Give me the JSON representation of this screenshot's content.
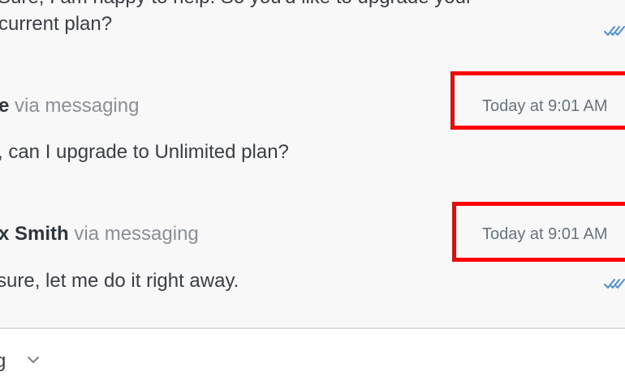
{
  "thread": {
    "messages": [
      {
        "partial_top_line": "Sure, I am happy to help. So you'd like to upgrade your",
        "continuation": "current plan?",
        "read_receipt_icon": "double-check-icon"
      },
      {
        "sender": "e",
        "channel": " via messaging",
        "timestamp": "Today at 9:01 AM",
        "body": ", can I upgrade to Unlimited plan?"
      },
      {
        "sender": "x Smith",
        "channel": " via messaging",
        "timestamp": "Today at 9:01 AM",
        "body": " sure, let me do it right away.",
        "read_receipt_icon": "double-check-icon"
      }
    ]
  },
  "composer": {
    "channel_selector_label": "g",
    "chevron_icon": "chevron-down-icon"
  },
  "annotation": {
    "highlight_color": "#ff0000"
  },
  "colors": {
    "accent_check": "#4d8fd6",
    "text": "#3a3f45",
    "meta": "#8a9096"
  }
}
